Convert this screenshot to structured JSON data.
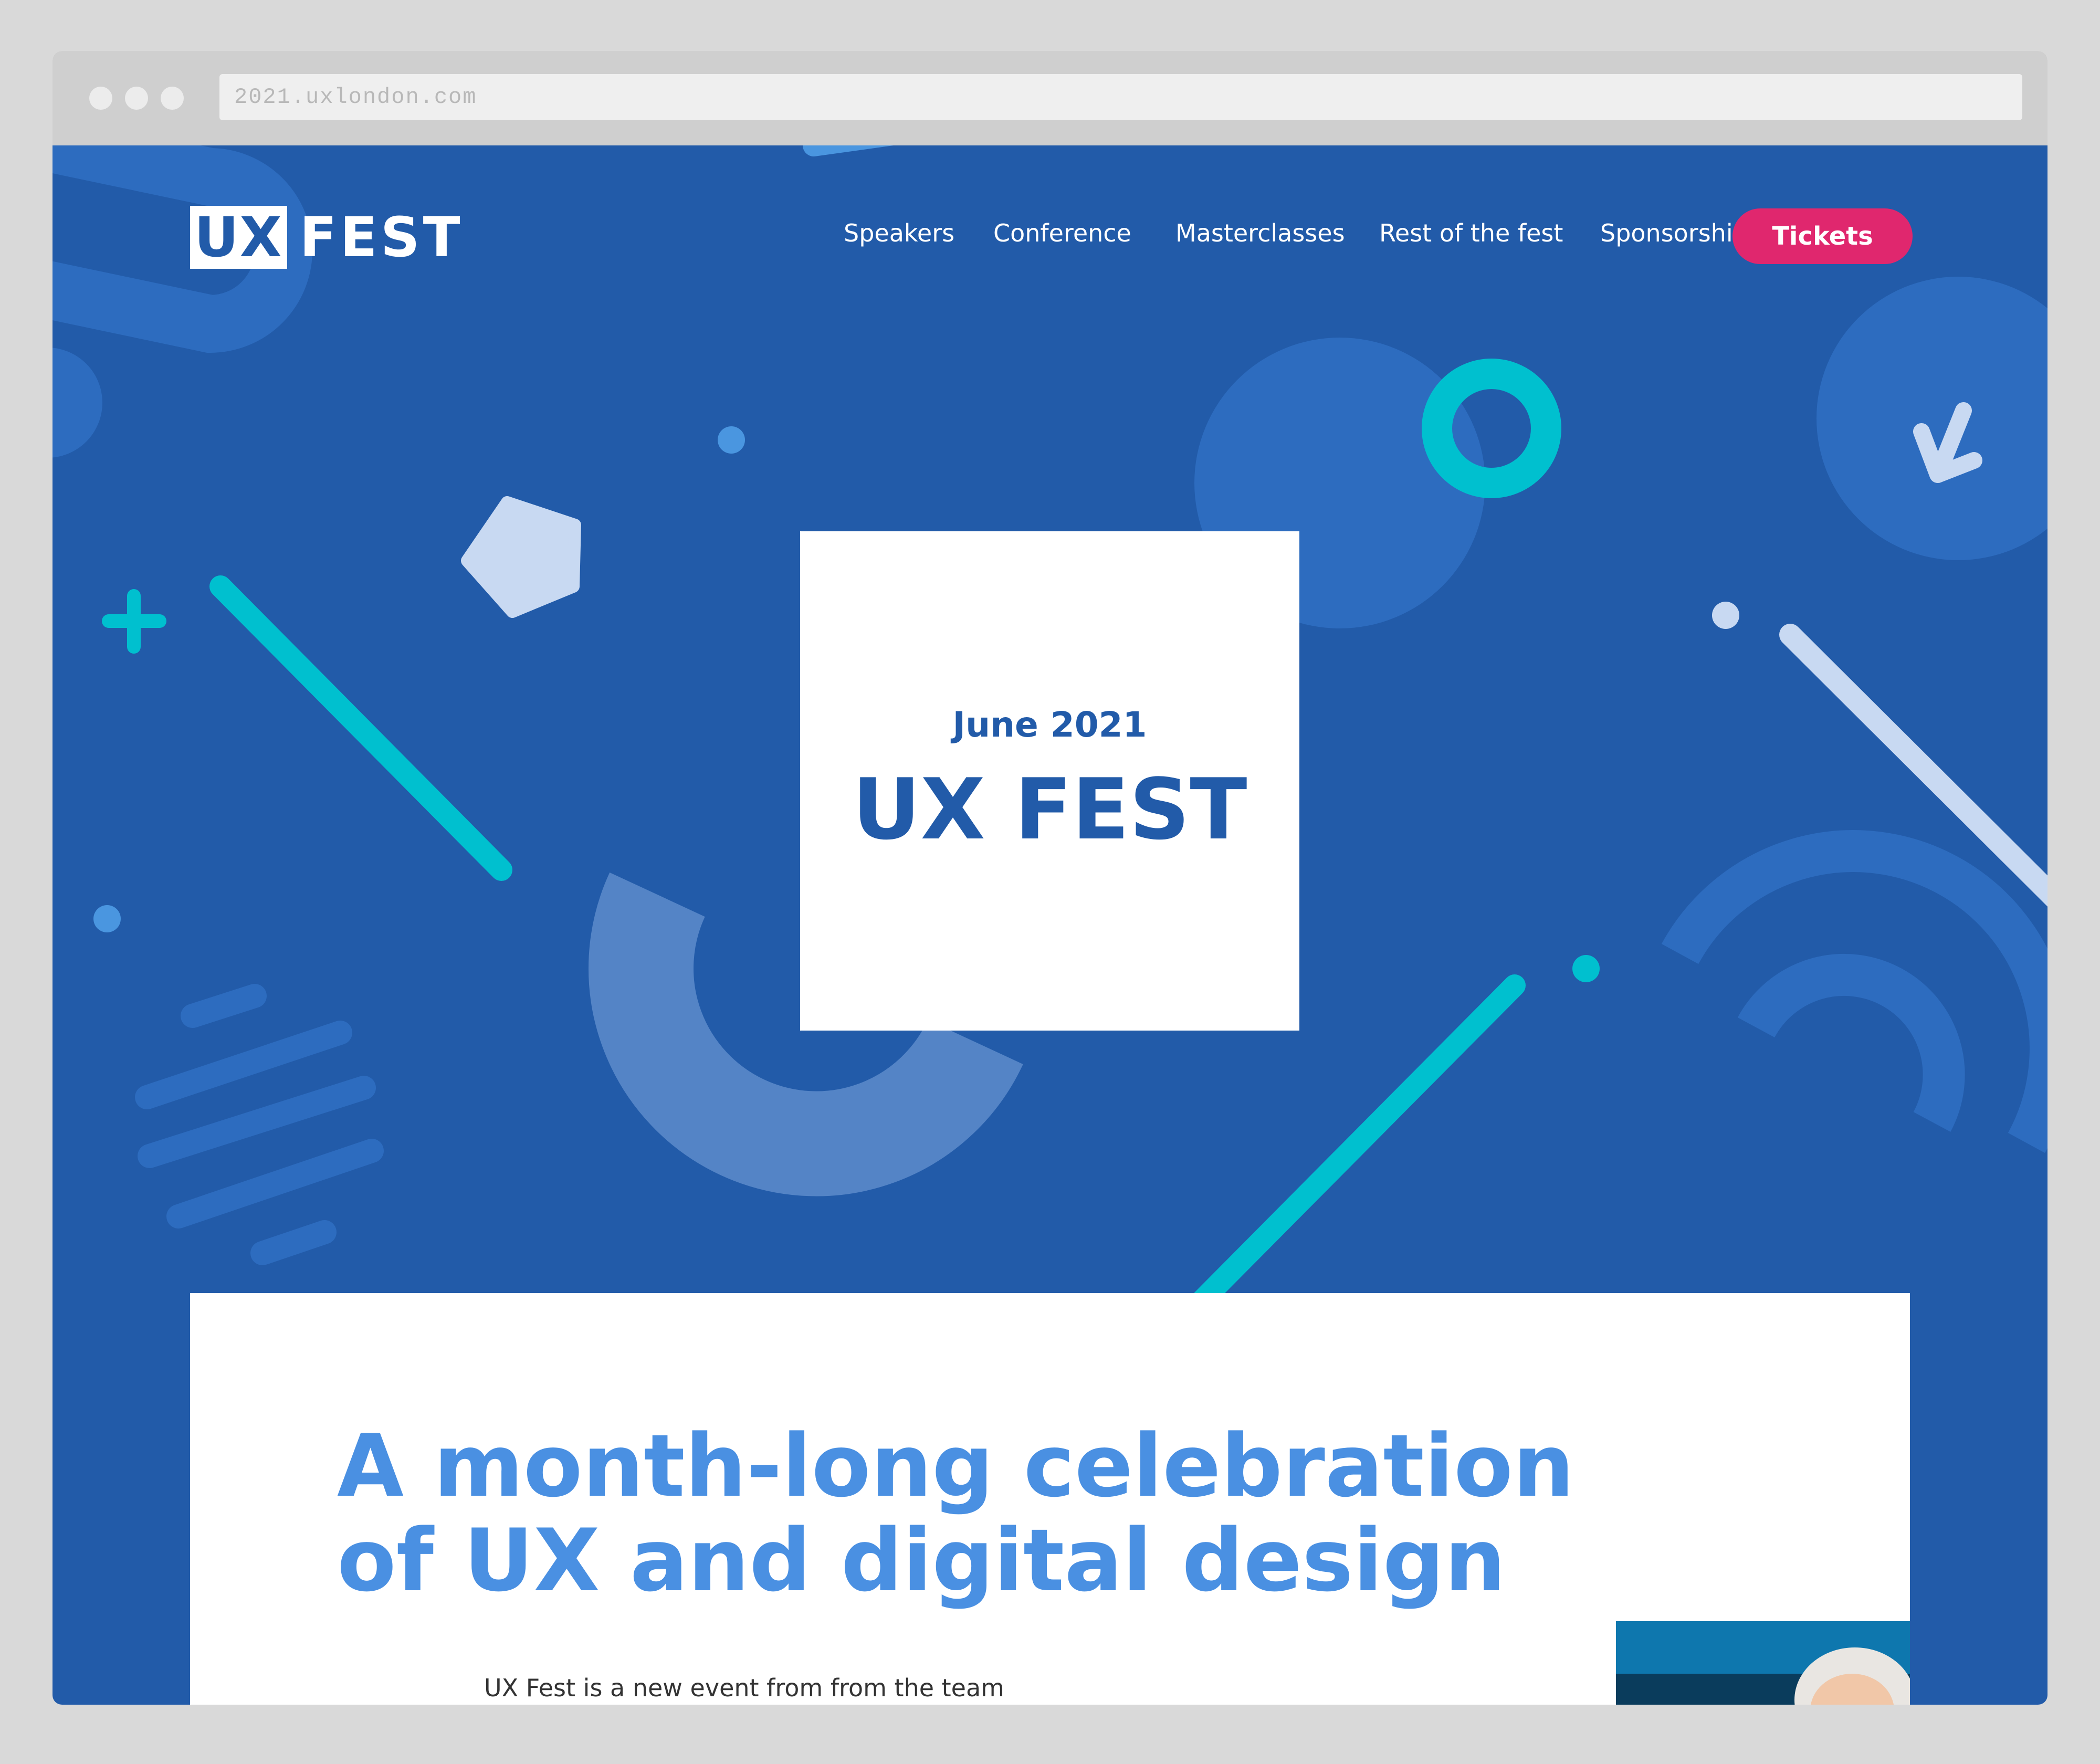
{
  "browser": {
    "url": "2021.uxlondon.com"
  },
  "logo": {
    "part1": "UX",
    "part2": "FEST"
  },
  "nav": {
    "items": [
      {
        "label": "Speakers"
      },
      {
        "label": "Conference"
      },
      {
        "label": "Masterclasses"
      },
      {
        "label": "Rest of the fest"
      },
      {
        "label": "Sponsorship"
      }
    ],
    "tickets_label": "Tickets"
  },
  "hero": {
    "date": "June 2021",
    "title": "UX FEST"
  },
  "content": {
    "headline_line1": "A month-long celebration",
    "headline_line2": "of UX and digital design",
    "intro": "UX Fest is a new event from from the team"
  },
  "colors": {
    "brand_blue": "#225ba9",
    "accent_pink": "#e0276e",
    "teal": "#00c0cf",
    "headline_blue": "#4a90e2"
  }
}
